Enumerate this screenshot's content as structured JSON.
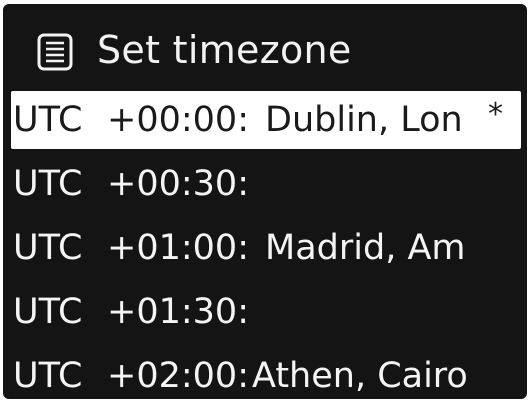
{
  "header": {
    "title": "Set timezone",
    "icon": "menu-list-icon"
  },
  "timezones": [
    {
      "zone": "UTC",
      "offset": "+00:00:",
      "cities": "Dublin, Lon",
      "marker": "*",
      "selected": true
    },
    {
      "zone": "UTC",
      "offset": "+00:30:",
      "cities": "",
      "marker": "",
      "selected": false
    },
    {
      "zone": "UTC",
      "offset": "+01:00:",
      "cities": "Madrid, Am",
      "marker": "",
      "selected": false
    },
    {
      "zone": "UTC",
      "offset": "+01:30:",
      "cities": "",
      "marker": "",
      "selected": false
    },
    {
      "zone": "UTC",
      "offset": "+02:00:",
      "cities": "Athen, Cairo",
      "marker": "",
      "selected": false
    }
  ],
  "colors": {
    "screen_background": "#141414",
    "text": "#f4f4f4",
    "highlight_background": "#ffffff",
    "highlight_text": "#1a1a1a"
  }
}
